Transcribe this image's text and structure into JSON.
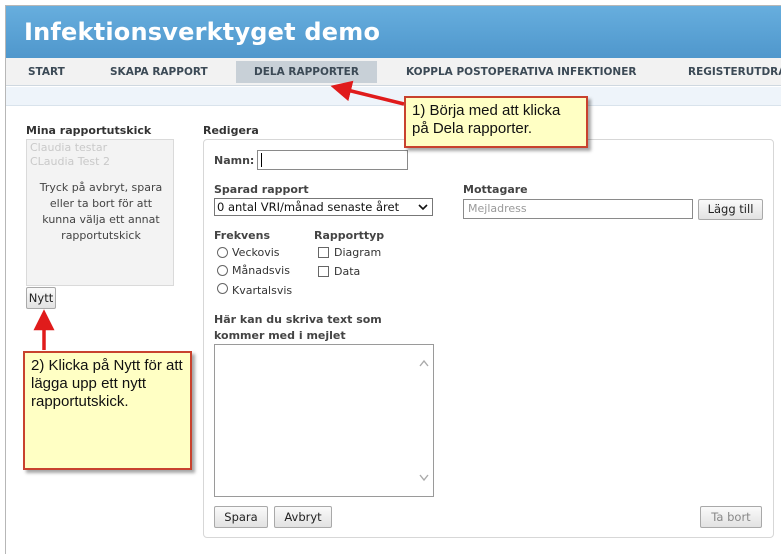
{
  "header": {
    "title": "Infektionsverktyget demo"
  },
  "nav": {
    "tabs": [
      {
        "label": "START"
      },
      {
        "label": "SKAPA RAPPORT"
      },
      {
        "label": "DELA RAPPORTER"
      },
      {
        "label": "KOPPLA POSTOPERATIVA INFEKTIONER"
      },
      {
        "label": "REGISTERUTDRAG"
      }
    ]
  },
  "left": {
    "heading": "Mina rapportutskick",
    "items": [
      "Claudia testar",
      "CLaudia Test 2"
    ],
    "hint": "Tryck på avbryt, spara eller ta bort för att kunna välja ett annat rapportutskick",
    "new_button": "Nytt"
  },
  "edit": {
    "heading": "Redigera",
    "name_label": "Namn:",
    "name_value": "",
    "saved_label": "Sparad rapport",
    "saved_value": "0 antal VRI/månad senaste året",
    "recipients_label": "Mottagare",
    "email_placeholder": "Mejladress",
    "add_button": "Lägg till",
    "frequency_label": "Frekvens",
    "frequency_options": [
      "Veckovis",
      "Månadsvis",
      "Kvartalsvis"
    ],
    "type_label": "Rapporttyp",
    "type_options": [
      "Diagram",
      "Data"
    ],
    "text_label": "Här kan du skriva text som kommer med i mejlet",
    "save_button": "Spara",
    "cancel_button": "Avbryt",
    "delete_button": "Ta bort"
  },
  "callouts": {
    "one": "1) Börja med att klicka på Dela rapporter.",
    "two": "2) Klicka på Nytt för att lägga upp ett nytt rapportutskick."
  },
  "colors": {
    "header": "#5aa2d6",
    "callout_bg": "#ffffc4",
    "callout_border": "#c8422e",
    "arrow": "#e01b1b"
  }
}
